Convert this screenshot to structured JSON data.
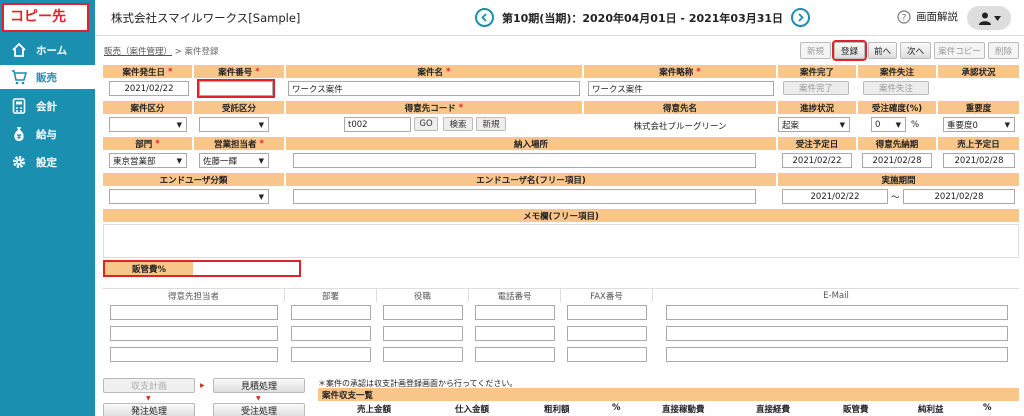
{
  "sidebar": {
    "copy_label": "コピー先",
    "items": [
      {
        "label": "ホーム",
        "icon": "home-icon"
      },
      {
        "label": "販売",
        "icon": "cart-icon"
      },
      {
        "label": "会計",
        "icon": "calculator-icon"
      },
      {
        "label": "給与",
        "icon": "money-bag-icon"
      },
      {
        "label": "設定",
        "icon": "gear-icon"
      }
    ]
  },
  "header": {
    "company": "株式会社スマイルワークス[Sample]",
    "period": "第10期(当期)：2020年04月01日 - 2021年03月31日",
    "help": "画面解説"
  },
  "breadcrumb": {
    "link": "販売（案件管理）",
    "separator": ">",
    "current": "案件登録"
  },
  "toolbar": {
    "new": "新規",
    "register": "登録",
    "prev": "前へ",
    "next": "次へ",
    "copy": "案件コピー",
    "delete": "削除"
  },
  "form": {
    "row1_headers": {
      "date": "案件発生日",
      "number": "案件番号",
      "name": "案件名",
      "abbr": "案件略称",
      "complete": "案件完了",
      "lost": "案件失注",
      "approval": "承認状況"
    },
    "date_value": "2021/02/22",
    "number_value": "",
    "name_value": "ワークス案件",
    "abbr_value": "ワークス案件",
    "complete_button": "案件完了",
    "lost_button": "案件失注",
    "row2_headers": {
      "category": "案件区分",
      "consign": "受託区分",
      "customer_code": "得意先コード",
      "customer_name": "得意先名",
      "progress": "進捗状況",
      "accuracy": "受注確度(%)",
      "importance": "重要度"
    },
    "customer_code_value": "t002",
    "go_button": "GO",
    "search_button": "検索",
    "new_button": "新規",
    "customer_name_value": "株式会社ブルーグリーン",
    "progress_value": "起案",
    "accuracy_value": "0",
    "percent": "%",
    "importance_value": "重要度0",
    "row3_headers": {
      "dept": "部門",
      "sales_person": "営業担当者",
      "delivery": "納入場所",
      "order_date": "受注予定日",
      "customer_due": "得意先納期",
      "sales_date": "売上予定日"
    },
    "dept_value": "東京営業部",
    "sales_person_value": "佐藤一輝",
    "order_date_value": "2021/02/22",
    "customer_due_value": "2021/02/28",
    "sales_date_value": "2021/02/28",
    "row4_headers": {
      "end_user_class": "エンドユーザ分類",
      "end_user_name": "エンドユーザ名(フリー項目)",
      "period": "実施期間"
    },
    "period_from": "2021/02/22",
    "period_tilde": "～",
    "period_to": "2021/02/28",
    "memo_header": "メモ欄(フリー項目)",
    "admin_cost_label": "販管費%"
  },
  "contacts": {
    "headers": [
      "得意先担当者",
      "部署",
      "役職",
      "電話番号",
      "FAX番号",
      "E-Mail"
    ]
  },
  "flow": {
    "plan": "収支計画",
    "estimate": "見積処理",
    "order": "発注処理",
    "receive": "受注処理",
    "note": "＊案件の承認は収支計画登録画面から行ってください。"
  },
  "list": {
    "title": "案件収支一覧",
    "columns": [
      "売上金額",
      "仕入金額",
      "粗利額",
      "%",
      "直接稼動費",
      "直接経費",
      "販管費",
      "純利益",
      "%"
    ]
  },
  "colors": {
    "sidebar": "#1b8fb0",
    "header_cell": "#f8c68a",
    "highlight": "#e0222a"
  }
}
